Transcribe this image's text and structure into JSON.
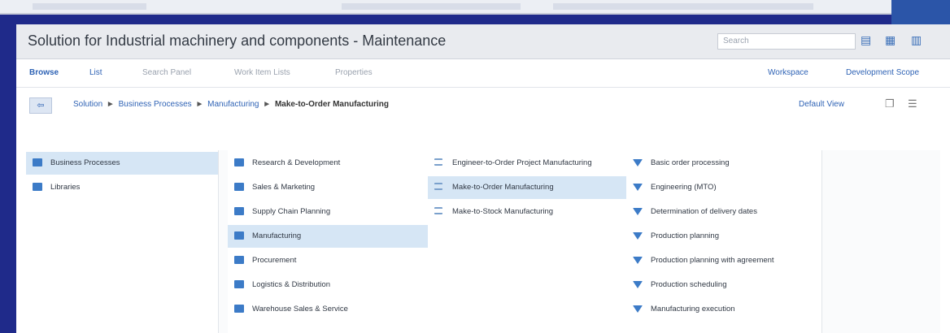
{
  "app": {
    "title": "Solution for Industrial machinery and components - Maintenance",
    "search_placeholder": "Search",
    "toolbar_icons": [
      "copy-icon",
      "grid-icon",
      "export-icon"
    ]
  },
  "nav": {
    "items": [
      "Browse",
      "List",
      "Search Panel",
      "Work Item Lists",
      "Properties"
    ],
    "active": "Browse",
    "right": [
      "Workspace",
      "Development Scope"
    ]
  },
  "breadcrumb": {
    "back": "⇦",
    "items": [
      "Solution",
      "Business Processes",
      "Manufacturing"
    ],
    "current": "Make-to-Order Manufacturing",
    "view": "Default View"
  },
  "columns": [
    {
      "items": [
        {
          "label": "Business Processes",
          "icon": "folder-icon",
          "selected": true
        },
        {
          "label": "Libraries",
          "icon": "folder-icon",
          "selected": false
        }
      ]
    },
    {
      "items": [
        {
          "label": "Research & Development",
          "icon": "folder-icon",
          "selected": false
        },
        {
          "label": "Sales & Marketing",
          "icon": "folder-icon",
          "selected": false
        },
        {
          "label": "Supply Chain Planning",
          "icon": "folder-icon",
          "selected": false
        },
        {
          "label": "Manufacturing",
          "icon": "folder-icon",
          "selected": true
        },
        {
          "label": "Procurement",
          "icon": "folder-icon",
          "selected": false
        },
        {
          "label": "Logistics & Distribution",
          "icon": "folder-icon",
          "selected": false
        },
        {
          "label": "Warehouse Sales & Service",
          "icon": "folder-icon",
          "selected": false
        }
      ]
    },
    {
      "items": [
        {
          "label": "Engineer-to-Order Project Manufacturing",
          "icon": "list-icon",
          "selected": false
        },
        {
          "label": "Make-to-Order Manufacturing",
          "icon": "list-icon",
          "selected": true
        },
        {
          "label": "Make-to-Stock Manufacturing",
          "icon": "list-icon",
          "selected": false
        }
      ]
    },
    {
      "items": [
        {
          "label": "Basic order processing",
          "icon": "filter-icon",
          "selected": false
        },
        {
          "label": "Engineering (MTO)",
          "icon": "filter-icon",
          "selected": false
        },
        {
          "label": "Determination of delivery dates",
          "icon": "filter-icon",
          "selected": false
        },
        {
          "label": "Production planning",
          "icon": "filter-icon",
          "selected": false
        },
        {
          "label": "Production planning with agreement",
          "icon": "filter-icon",
          "selected": false
        },
        {
          "label": "Production scheduling",
          "icon": "filter-icon",
          "selected": false
        },
        {
          "label": "Manufacturing execution",
          "icon": "filter-icon",
          "selected": false
        }
      ]
    }
  ]
}
